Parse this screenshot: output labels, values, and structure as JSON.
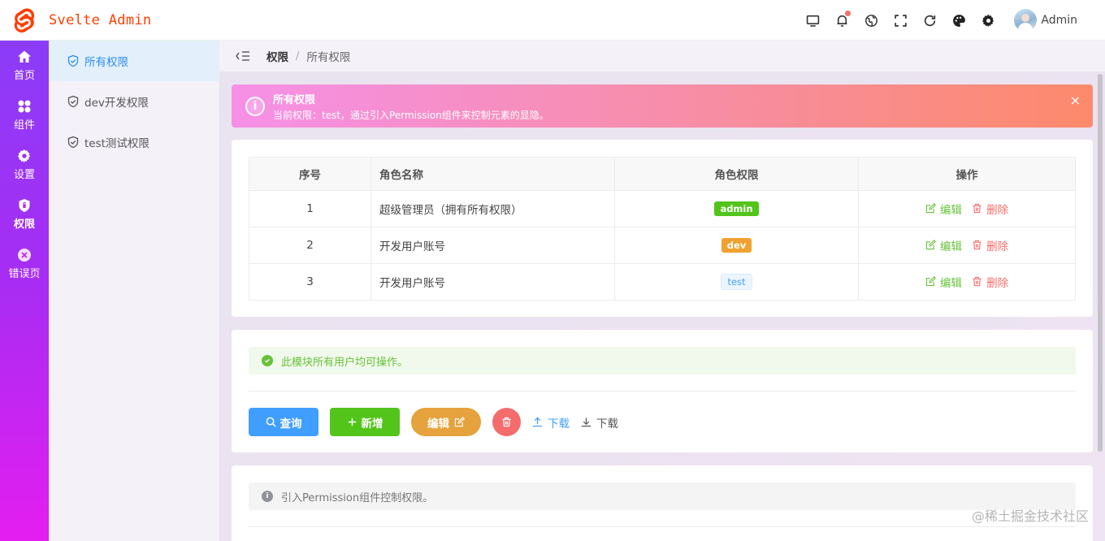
{
  "app": {
    "title": "Svelte Admin",
    "brand_color": "#ff3e00"
  },
  "header": {
    "tools": [
      "monitor-icon",
      "bell-icon",
      "globe-icon",
      "fullscreen-icon",
      "refresh-icon",
      "palette-icon",
      "gear-icon"
    ],
    "user_name": "Admin"
  },
  "rail": {
    "items": [
      {
        "label": "首页",
        "icon": "home-icon"
      },
      {
        "label": "组件",
        "icon": "components-icon"
      },
      {
        "label": "设置",
        "icon": "settings-icon"
      },
      {
        "label": "权限",
        "icon": "shield-icon",
        "active": true
      },
      {
        "label": "错误页",
        "icon": "error-icon"
      }
    ]
  },
  "submenu": {
    "items": [
      {
        "label": "所有权限",
        "active": true
      },
      {
        "label": "dev开发权限"
      },
      {
        "label": "test测试权限"
      }
    ]
  },
  "breadcrumb": {
    "parent": "权限",
    "separator": "/",
    "current": "所有权限"
  },
  "alert": {
    "title": "所有权限",
    "description": "当前权限：test，通过引入Permission组件来控制元素的显隐。",
    "close": "×"
  },
  "table": {
    "headers": [
      "序号",
      "角色名称",
      "角色权限",
      "操作"
    ],
    "rows": [
      {
        "index": "1",
        "name": "超级管理员（拥有所有权限）",
        "perm": "admin"
      },
      {
        "index": "2",
        "name": "开发用户账号",
        "perm": "dev"
      },
      {
        "index": "3",
        "name": "开发用户账号",
        "perm": "test"
      }
    ],
    "edit_label": "编辑",
    "delete_label": "删除"
  },
  "section2": {
    "notice": "此模块所有用户均可操作。",
    "buttons": {
      "query": "查询",
      "add": "新增",
      "edit": "编辑"
    },
    "links": {
      "upload": "下载",
      "download": "下载"
    }
  },
  "section3": {
    "notice": "引入Permission组件控制权限。"
  },
  "watermark": "@稀土掘金技术社区",
  "colors": {
    "rail_gradient_top": "#8b3cf7",
    "rail_gradient_bottom": "#e41ef0",
    "primary": "#409eff",
    "success": "#52c41a",
    "warning": "#e6a23c",
    "danger": "#f56c6c"
  }
}
